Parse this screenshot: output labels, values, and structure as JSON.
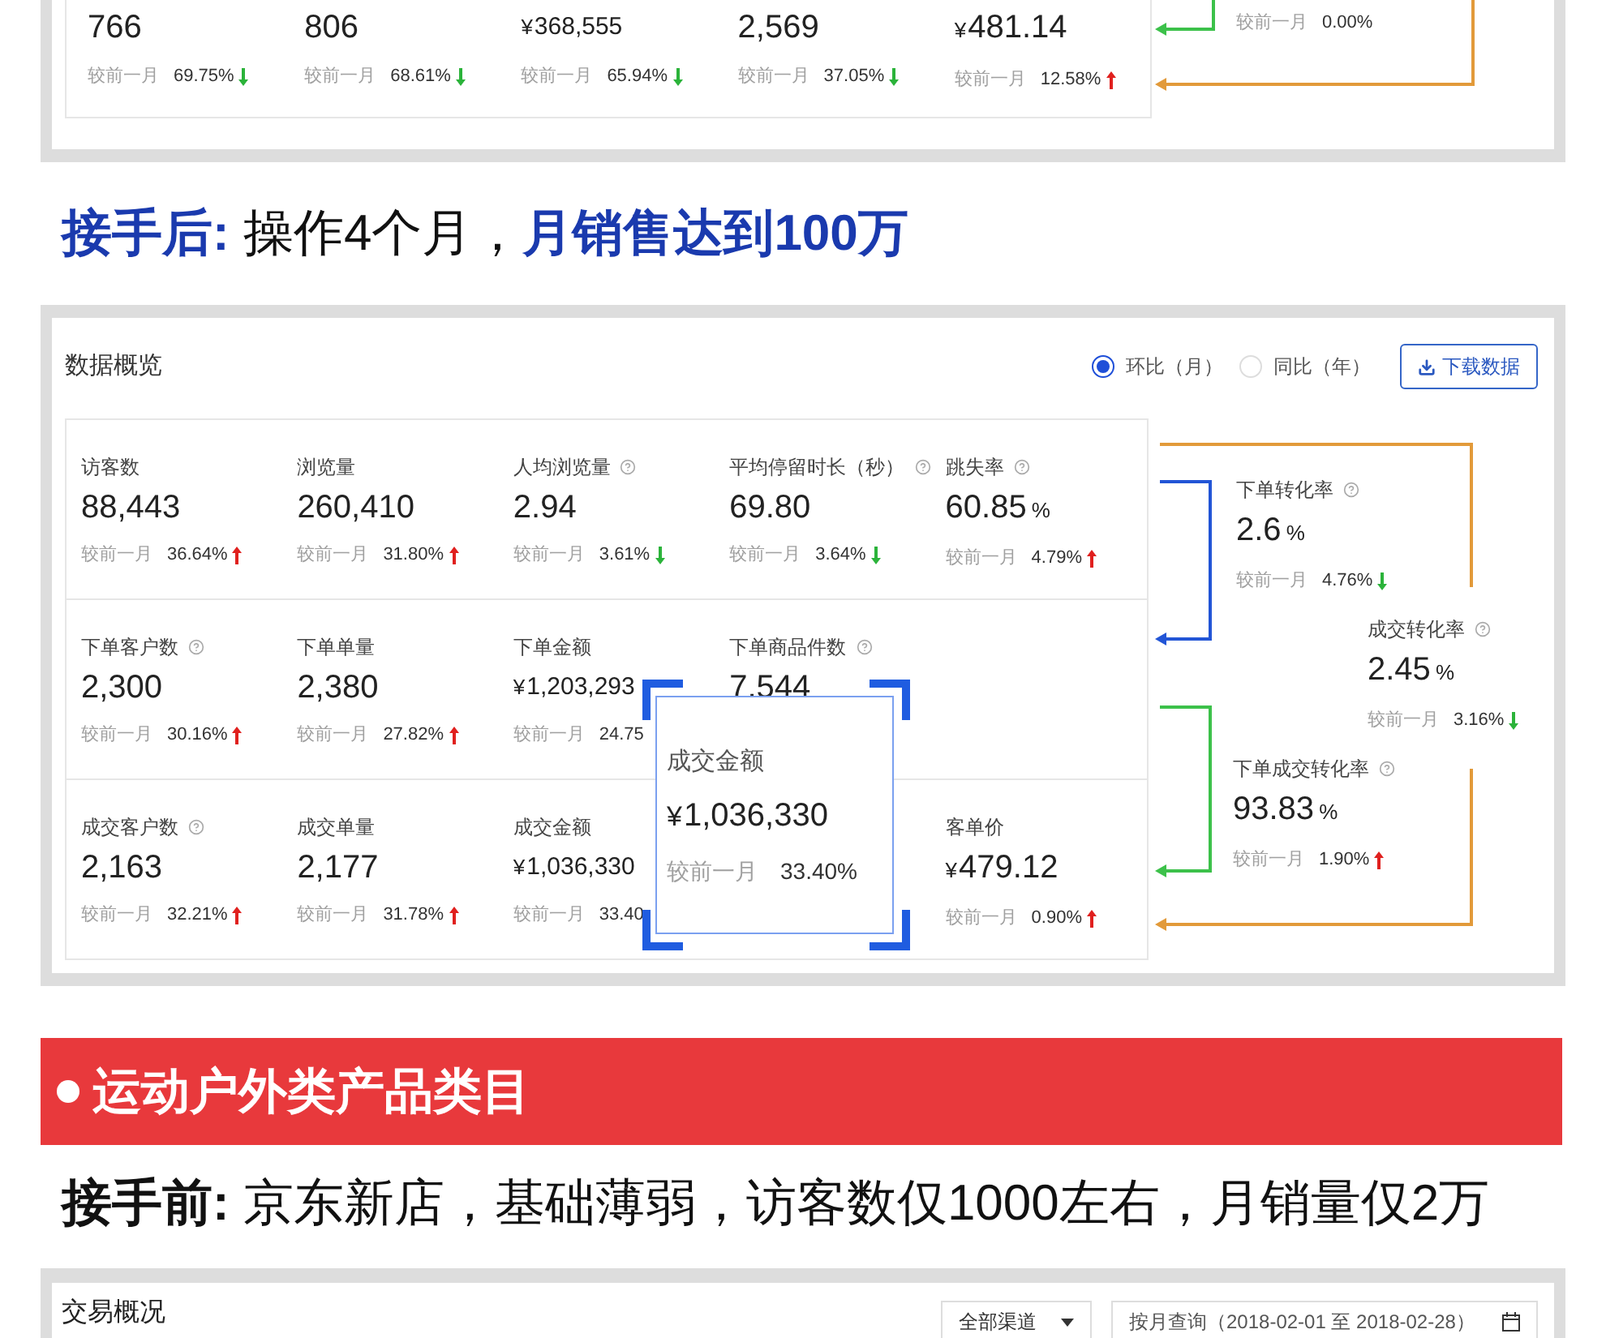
{
  "top_panel": {
    "metrics": [
      {
        "value": "766",
        "compare": "较前一月",
        "change": "69.75%",
        "rising": false
      },
      {
        "value": "806",
        "compare": "较前一月",
        "change": "68.61%",
        "rising": false
      },
      {
        "currency": "¥",
        "value": "368,555",
        "compare": "较前一月",
        "change": "65.94%",
        "rising": false
      },
      {
        "value": "2,569",
        "compare": "较前一月",
        "change": "37.05%",
        "rising": false
      },
      {
        "currency": "¥",
        "value": "481.14",
        "compare": "较前一月",
        "change": "12.58%",
        "rising": true
      }
    ],
    "side": {
      "compare": "较前一月",
      "change": "0.00%"
    }
  },
  "headline_after": {
    "parts": [
      {
        "text": "接手后:",
        "emphasis": true,
        "color": "#1a3aae"
      },
      {
        "text": " 操作4个月，",
        "emphasis": false,
        "color": "#111111"
      },
      {
        "text": "月销售达到100万",
        "emphasis": true,
        "color": "#1a3aae"
      }
    ]
  },
  "overview_panel": {
    "title": "数据概览",
    "options": [
      {
        "label": "环比（月）",
        "selected": true
      },
      {
        "label": "同比（年）",
        "selected": false
      }
    ],
    "download_button": "下载数据",
    "rows": [
      [
        {
          "label": "访客数",
          "help": false,
          "value": "88,443",
          "compare": "较前一月",
          "change": "36.64%",
          "rising": true
        },
        {
          "label": "浏览量",
          "help": false,
          "value": "260,410",
          "compare": "较前一月",
          "change": "31.80%",
          "rising": true
        },
        {
          "label": "人均浏览量",
          "help": true,
          "value": "2.94",
          "compare": "较前一月",
          "change": "3.61%",
          "rising": false
        },
        {
          "label": "平均停留时长（秒）",
          "help": true,
          "value": "69.80",
          "compare": "较前一月",
          "change": "3.64%",
          "rising": false
        },
        {
          "label": "跳失率",
          "help": true,
          "value": "60.85",
          "unit": "%",
          "compare": "较前一月",
          "change": "4.79%",
          "rising": true
        }
      ],
      [
        {
          "label": "下单客户数",
          "help": true,
          "value": "2,300",
          "compare": "较前一月",
          "change": "30.16%",
          "rising": true
        },
        {
          "label": "下单单量",
          "help": false,
          "value": "2,380",
          "compare": "较前一月",
          "change": "27.82%",
          "rising": true
        },
        {
          "label": "下单金额",
          "help": false,
          "currency": "¥",
          "value": "1,203,293",
          "compare": "较前一月",
          "change": "24.75"
        },
        {
          "label": "下单商品件数",
          "help": true,
          "value": "7,544"
        },
        {}
      ],
      [
        {
          "label": "成交客户数",
          "help": true,
          "value": "2,163",
          "compare": "较前一月",
          "change": "32.21%",
          "rising": true
        },
        {
          "label": "成交单量",
          "help": false,
          "value": "2,177",
          "compare": "较前一月",
          "change": "31.78%",
          "rising": true
        },
        {
          "label": "成交金额",
          "help": false,
          "currency": "¥",
          "value": "1,036,330",
          "compare": "较前一月",
          "change": "33.40"
        },
        {},
        {
          "label": "客单价",
          "help": false,
          "currency": "¥",
          "value": "479.12",
          "compare": "较前一月",
          "change": "0.90%",
          "rising": true
        }
      ]
    ],
    "highlight": {
      "label": "成交金额",
      "currency": "¥",
      "value": "1,036,330",
      "compare": "较前一月",
      "change": "33.40%"
    },
    "funnel": [
      {
        "label": "下单转化率",
        "help": true,
        "value": "2.6",
        "unit": "%",
        "compare": "较前一月",
        "change": "4.76%",
        "rising": false
      },
      {
        "label": "成交转化率",
        "help": true,
        "value": "2.45",
        "unit": "%",
        "compare": "较前一月",
        "change": "3.16%",
        "rising": false
      },
      {
        "label": "下单成交转化率",
        "help": true,
        "value": "93.83",
        "unit": "%",
        "compare": "较前一月",
        "change": "1.90%",
        "rising": true
      }
    ]
  },
  "category_banner": {
    "title": "运动户外类产品类目"
  },
  "headline_before": {
    "parts": [
      {
        "text": "接手前:",
        "emphasis": true,
        "color": "#111111"
      },
      {
        "text": " 京东新店，基础薄弱，访客数仅1000左右，月销量仅2万",
        "emphasis": false,
        "color": "#111111"
      }
    ]
  },
  "trade_panel": {
    "title": "交易概况",
    "channel_select": "全部渠道",
    "date_field": "按月查询（2018-02-01 至 2018-02-28）"
  }
}
